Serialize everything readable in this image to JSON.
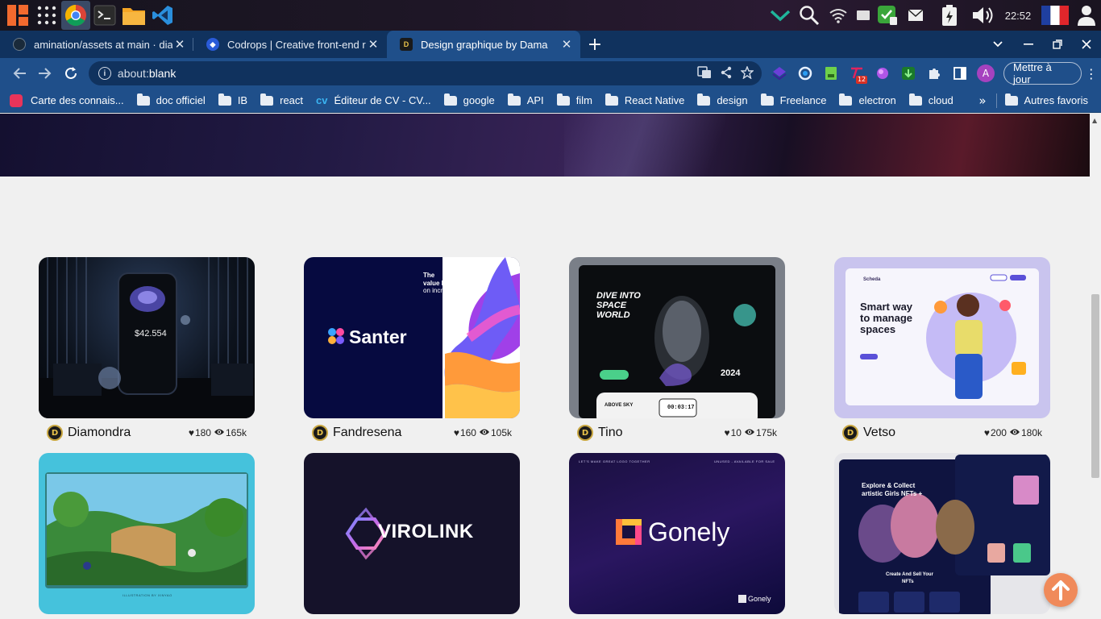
{
  "taskbar": {
    "apps": [
      "launcher-icon",
      "app-grid-icon",
      "chrome-icon",
      "terminal-icon",
      "files-icon",
      "vscode-icon"
    ],
    "clock": "22:52",
    "tray": [
      "chevron-down-icon",
      "search-icon",
      "wifi-icon",
      "battery-icon",
      "update-icon",
      "mail-icon",
      "power-icon",
      "volume-icon",
      "flag-icon",
      "user-icon"
    ]
  },
  "tabs": [
    {
      "title": "amination/assets at main · diam",
      "active": false
    },
    {
      "title": "Codrops | Creative front-end re",
      "active": false
    },
    {
      "title": "Design graphique by Dama",
      "active": true
    }
  ],
  "toolbar": {
    "url_prefix": "about:",
    "url_main": "blank",
    "update_label": "Mettre à jour",
    "avatar_letter": "A",
    "ext_badge": "12"
  },
  "bookmarks": [
    {
      "label": "Carte des connais...",
      "kind": "site"
    },
    {
      "label": "doc officiel",
      "kind": "folder"
    },
    {
      "label": "IB",
      "kind": "folder"
    },
    {
      "label": "react",
      "kind": "folder"
    },
    {
      "label": "Éditeur de CV - CV...",
      "kind": "site"
    },
    {
      "label": "google",
      "kind": "folder"
    },
    {
      "label": "API",
      "kind": "folder"
    },
    {
      "label": "film",
      "kind": "folder"
    },
    {
      "label": "React Native",
      "kind": "folder"
    },
    {
      "label": "design",
      "kind": "folder"
    },
    {
      "label": "Freelance",
      "kind": "folder"
    },
    {
      "label": "electron",
      "kind": "folder"
    },
    {
      "label": "cloud",
      "kind": "folder"
    }
  ],
  "bookmarks_more": "»",
  "bookmarks_other": "Autres favoris",
  "cards": [
    {
      "author": "Diamondra",
      "likes": "180",
      "views": "165k",
      "art": {
        "price": "$42.554"
      }
    },
    {
      "author": "Fandresena",
      "likes": "160",
      "views": "105k",
      "art": {
        "brand": "Santer",
        "tagline1": "The",
        "tagline2": "value keeps",
        "tagline3": "on increasing"
      }
    },
    {
      "author": "Tino",
      "likes": "10",
      "views": "175k",
      "art": {
        "headline1": "DIVE INTO",
        "headline2": "SPACE",
        "headline3": "WORLD",
        "year": "2024",
        "time": "00:03:17",
        "tag": "ABOVE SKY"
      }
    },
    {
      "author": "Vetso",
      "likes": "200",
      "views": "180k",
      "art": {
        "brand": "Scheda",
        "headline1": "Smart way",
        "headline2": "to manage",
        "headline3": "spaces"
      }
    },
    {
      "author": "",
      "likes": "",
      "views": "",
      "art": {
        "caption": "ILLUSTRATION BY XINYAO"
      }
    },
    {
      "author": "",
      "likes": "",
      "views": "",
      "art": {
        "brand": "VIROLINK"
      }
    },
    {
      "author": "",
      "likes": "",
      "views": "",
      "art": {
        "brand": "Gonely",
        "top_left": "LET'S MAKE GREAT LOGO TOGETHER",
        "top_right": "UNUSED - AVAILABLE FOR SALE",
        "small_brand": "Gonely"
      }
    },
    {
      "author": "",
      "likes": "",
      "views": "",
      "art": {
        "headline1": "Explore & Collect",
        "headline2": "artistic Girls NFTs +",
        "subline1": "Create And Sell Your",
        "subline2": "NFTs"
      }
    }
  ],
  "colors": {
    "tab_strip": "#10325e",
    "toolbar": "#1f4f8a",
    "page_bg": "#f0f0f0",
    "fab": "#f08a5a"
  }
}
